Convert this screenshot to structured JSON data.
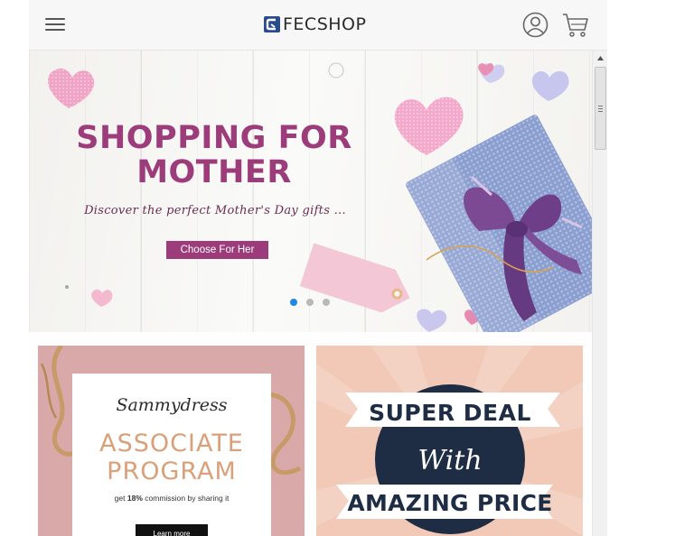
{
  "header": {
    "logo_text": "FECSHOP",
    "menu_icon": "hamburger-menu-icon",
    "account_icon": "user-account-icon",
    "cart_icon": "shopping-cart-icon"
  },
  "hero": {
    "title_line1": "SHOPPING FOR",
    "title_line2": "MOTHER",
    "subtitle": "Discover the perfect Mother's Day gifts ...",
    "button_label": "Choose For Her",
    "slides_total": 3,
    "active_slide": 1
  },
  "promos": [
    {
      "brand": "Sammydress",
      "headline_line1": "ASSOCIATE",
      "headline_line2": "PROGRAM",
      "commission_prefix": "get",
      "commission_value": "18%",
      "commission_suffix": "commission by sharing it",
      "button_label": "Learn more"
    },
    {
      "line1": "SUPER DEAL",
      "line2": "With",
      "line3": "AMAZING PRICE"
    }
  ],
  "colors": {
    "accent": "#9c3c7a",
    "dot_active": "#1e88e5",
    "deal_navy": "#1f2d44",
    "logo_blue": "#2c4a8f"
  }
}
